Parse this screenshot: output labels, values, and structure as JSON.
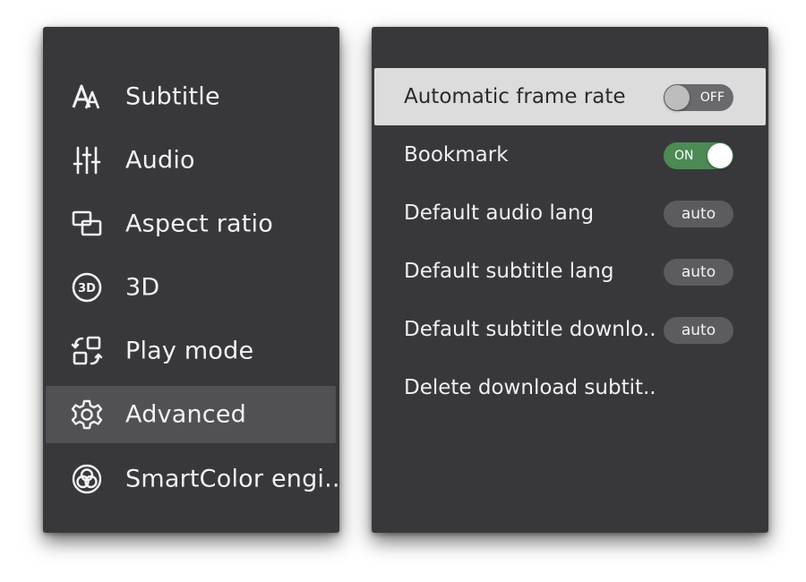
{
  "menu": {
    "items": [
      {
        "label": "Subtitle",
        "icon": "subtitle-icon"
      },
      {
        "label": "Audio",
        "icon": "audio-equalizer-icon"
      },
      {
        "label": "Aspect ratio",
        "icon": "aspect-ratio-icon"
      },
      {
        "label": "3D",
        "icon": "3d-icon"
      },
      {
        "label": "Play mode",
        "icon": "play-mode-icon"
      },
      {
        "label": "Advanced",
        "icon": "gear-icon",
        "active": true
      },
      {
        "label": "SmartColor engi..",
        "icon": "smartcolor-icon"
      }
    ]
  },
  "settings": {
    "rows": [
      {
        "label": "Automatic frame rate",
        "control": "toggle",
        "value": "OFF"
      },
      {
        "label": "Bookmark",
        "control": "toggle",
        "value": "ON"
      },
      {
        "label": "Default audio lang",
        "control": "pill",
        "value": "auto"
      },
      {
        "label": "Default subtitle lang",
        "control": "pill",
        "value": "auto"
      },
      {
        "label": "Default subtitle downlo..",
        "control": "pill",
        "value": "auto"
      },
      {
        "label": "Delete download subtit..",
        "control": "none"
      }
    ]
  },
  "colors": {
    "panel_bg": "#38383c",
    "active_item_bg": "#505055",
    "selected_row_bg": "#dcdcdc",
    "toggle_on": "#4d8a55",
    "toggle_off": "#6a6a6e",
    "pill_bg": "#5c5c60"
  }
}
